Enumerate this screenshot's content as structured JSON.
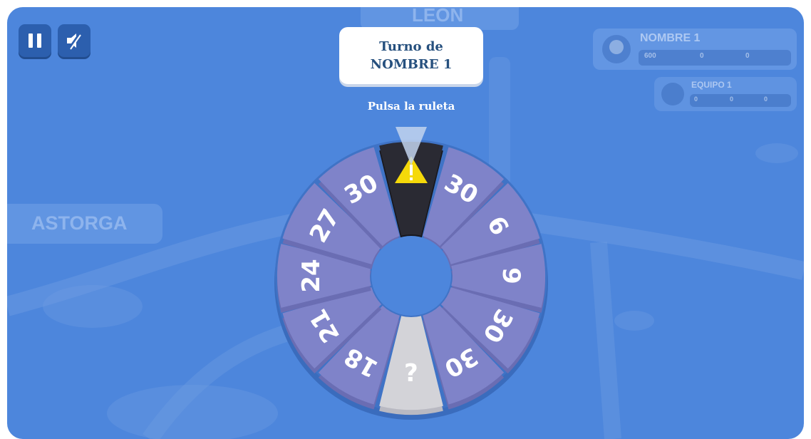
{
  "turn": {
    "line1": "Turno de",
    "line2": "NOMBRE 1"
  },
  "prompt": "Pulsa la ruleta",
  "map": {
    "city_left": "ASTORGA",
    "city_top": "LEON"
  },
  "hud": {
    "player_name": "NOMBRE 1",
    "team_name": "EQUIPO 1",
    "player_stats": [
      "600",
      "0",
      "0"
    ],
    "team_stats": [
      "0",
      "0",
      "0"
    ]
  },
  "wheel": {
    "segments": [
      {
        "label": "",
        "type": "warning"
      },
      {
        "label": "30",
        "type": "number"
      },
      {
        "label": "6",
        "type": "number"
      },
      {
        "label": "9",
        "type": "number"
      },
      {
        "label": "30",
        "type": "number"
      },
      {
        "label": "30",
        "type": "number"
      },
      {
        "label": "¿",
        "type": "question"
      },
      {
        "label": "18",
        "type": "number"
      },
      {
        "label": "21",
        "type": "number"
      },
      {
        "label": "24",
        "type": "number"
      },
      {
        "label": "27",
        "type": "number"
      },
      {
        "label": "30",
        "type": "number"
      }
    ]
  },
  "colors": {
    "background": "#4d86dc",
    "segment": "#7f83c9",
    "segment_edge": "#6a6db3",
    "warning_segment": "#2a2a33",
    "question_segment": "#d3d3d8",
    "warning_triangle": "#f5d90a",
    "pointer": "#c2d3ee"
  },
  "icons": {
    "pause": "pause-icon",
    "sound": "mute-icon"
  }
}
